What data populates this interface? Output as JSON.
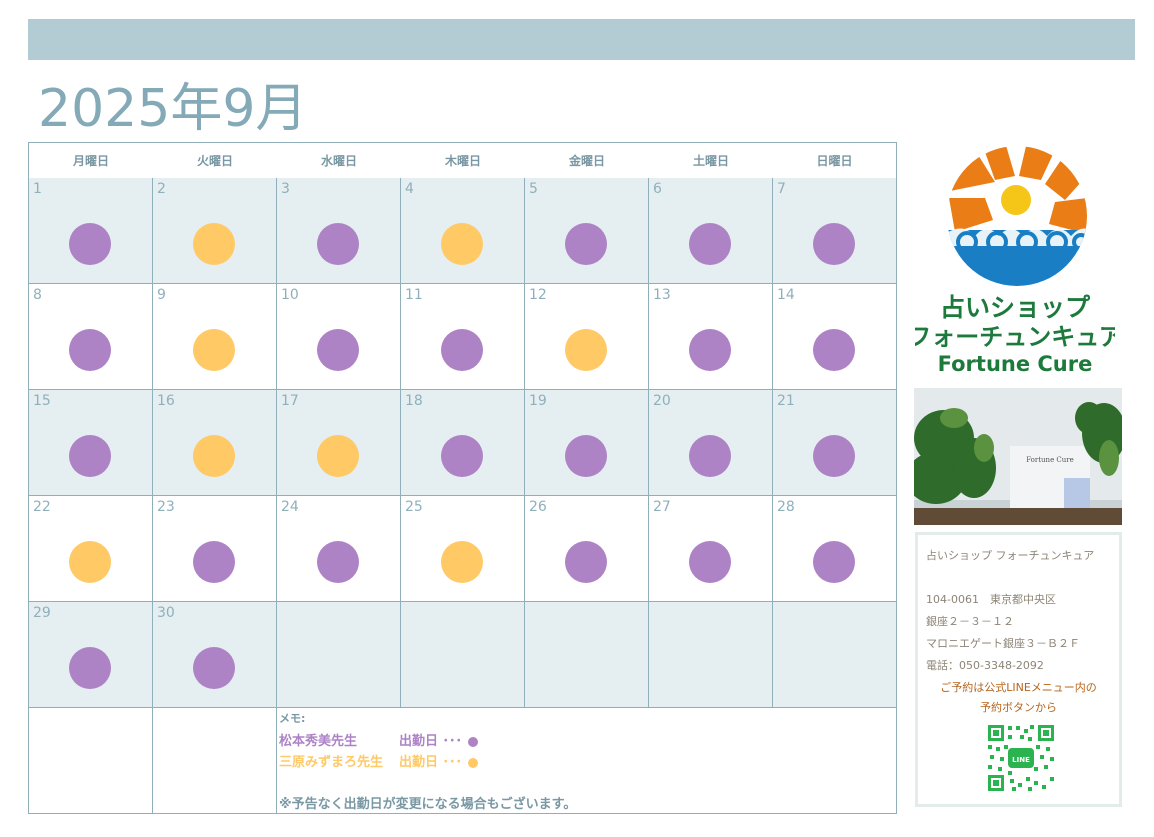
{
  "title": "2025年9月",
  "weekdays": [
    "月曜日",
    "火曜日",
    "水曜日",
    "木曜日",
    "金曜日",
    "土曜日",
    "日曜日"
  ],
  "colors": {
    "purple": "#ad83c6",
    "yellow": "#ffc966",
    "header_bar": "#b3cbd3",
    "accent": "#84a9b7"
  },
  "days": [
    {
      "n": "1",
      "c": "purple"
    },
    {
      "n": "2",
      "c": "yellow"
    },
    {
      "n": "3",
      "c": "purple"
    },
    {
      "n": "4",
      "c": "yellow"
    },
    {
      "n": "5",
      "c": "purple"
    },
    {
      "n": "6",
      "c": "purple"
    },
    {
      "n": "7",
      "c": "purple"
    },
    {
      "n": "8",
      "c": "purple"
    },
    {
      "n": "9",
      "c": "yellow"
    },
    {
      "n": "10",
      "c": "purple"
    },
    {
      "n": "11",
      "c": "purple"
    },
    {
      "n": "12",
      "c": "yellow"
    },
    {
      "n": "13",
      "c": "purple"
    },
    {
      "n": "14",
      "c": "purple"
    },
    {
      "n": "15",
      "c": "purple"
    },
    {
      "n": "16",
      "c": "yellow"
    },
    {
      "n": "17",
      "c": "yellow"
    },
    {
      "n": "18",
      "c": "purple"
    },
    {
      "n": "19",
      "c": "purple"
    },
    {
      "n": "20",
      "c": "purple"
    },
    {
      "n": "21",
      "c": "purple"
    },
    {
      "n": "22",
      "c": "yellow"
    },
    {
      "n": "23",
      "c": "purple"
    },
    {
      "n": "24",
      "c": "purple"
    },
    {
      "n": "25",
      "c": "yellow"
    },
    {
      "n": "26",
      "c": "purple"
    },
    {
      "n": "27",
      "c": "purple"
    },
    {
      "n": "28",
      "c": "purple"
    },
    {
      "n": "29",
      "c": "purple"
    },
    {
      "n": "30",
      "c": "purple"
    },
    {
      "n": "",
      "c": ""
    },
    {
      "n": "",
      "c": ""
    },
    {
      "n": "",
      "c": ""
    },
    {
      "n": "",
      "c": ""
    },
    {
      "n": "",
      "c": ""
    }
  ],
  "memo": {
    "label": "メモ:",
    "line1": {
      "name": "松本秀美先生",
      "text": "出勤日 ･･･",
      "color": "purple"
    },
    "line2": {
      "name": "三原みずまろ先生",
      "text": "出勤日 ･･･",
      "color": "yellow"
    },
    "note": "※予告なく出勤日が変更になる場合もございます。"
  },
  "logo": {
    "line1": "占いショップ",
    "line2": "フォーチュンキュア",
    "line3": "Fortune Cure"
  },
  "photo_sign": "Fortune Cure",
  "info": {
    "name": "占いショップ フォーチュンキュア",
    "address1": "104-0061　東京都中央区",
    "address2": "銀座２－３－１２",
    "address3": "マロニエゲート銀座３－Ｂ２Ｆ",
    "phone": "電話：050-3348-2092",
    "reserve1": "ご予約は公式LINEメニュー内の",
    "reserve2": "予約ボタンから",
    "qr_label": "LINE"
  }
}
